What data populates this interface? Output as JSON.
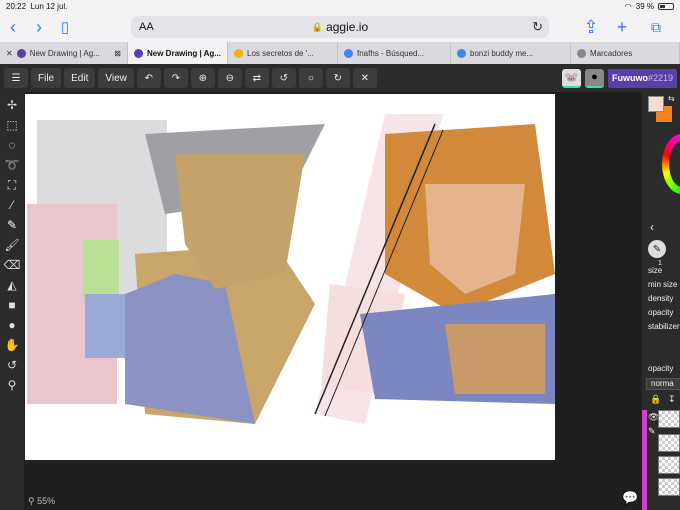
{
  "status": {
    "time": "20:22",
    "date": "Lun 12 jul.",
    "battery_pct": "39 %",
    "battery_level": 0.39
  },
  "browser": {
    "aa_label": "AA",
    "url": "aggie.io"
  },
  "tabs": [
    {
      "title": "New Drawing | Ag...",
      "favicon_color": "#5b3fa8"
    },
    {
      "title": "New Drawing | Ag...",
      "favicon_color": "#5b3fa8"
    },
    {
      "title": "Los secretos de '...",
      "favicon_color": "#f4b400"
    },
    {
      "title": "fnafhs - Búsqued...",
      "favicon_color": "#4285f4"
    },
    {
      "title": "bonzi buddy me...",
      "favicon_color": "#4285f4"
    },
    {
      "title": "Marcadores",
      "favicon_color": "#888888"
    }
  ],
  "menu": {
    "file": "File",
    "edit": "Edit",
    "view": "View"
  },
  "user": {
    "name": "Fuwuwo",
    "tag": "#2219"
  },
  "colors": {
    "primary": "#f7dccf",
    "secondary": "#f5821f",
    "accent": "#5b3fa8"
  },
  "brush": {
    "size_value": "1"
  },
  "props": {
    "size": "size",
    "min_size": "min size",
    "density": "density",
    "opacity": "opacity",
    "stabilizer": "stabilizer",
    "layer_opacity": "opacity",
    "blend_mode": "norma"
  },
  "zoom": "55%"
}
